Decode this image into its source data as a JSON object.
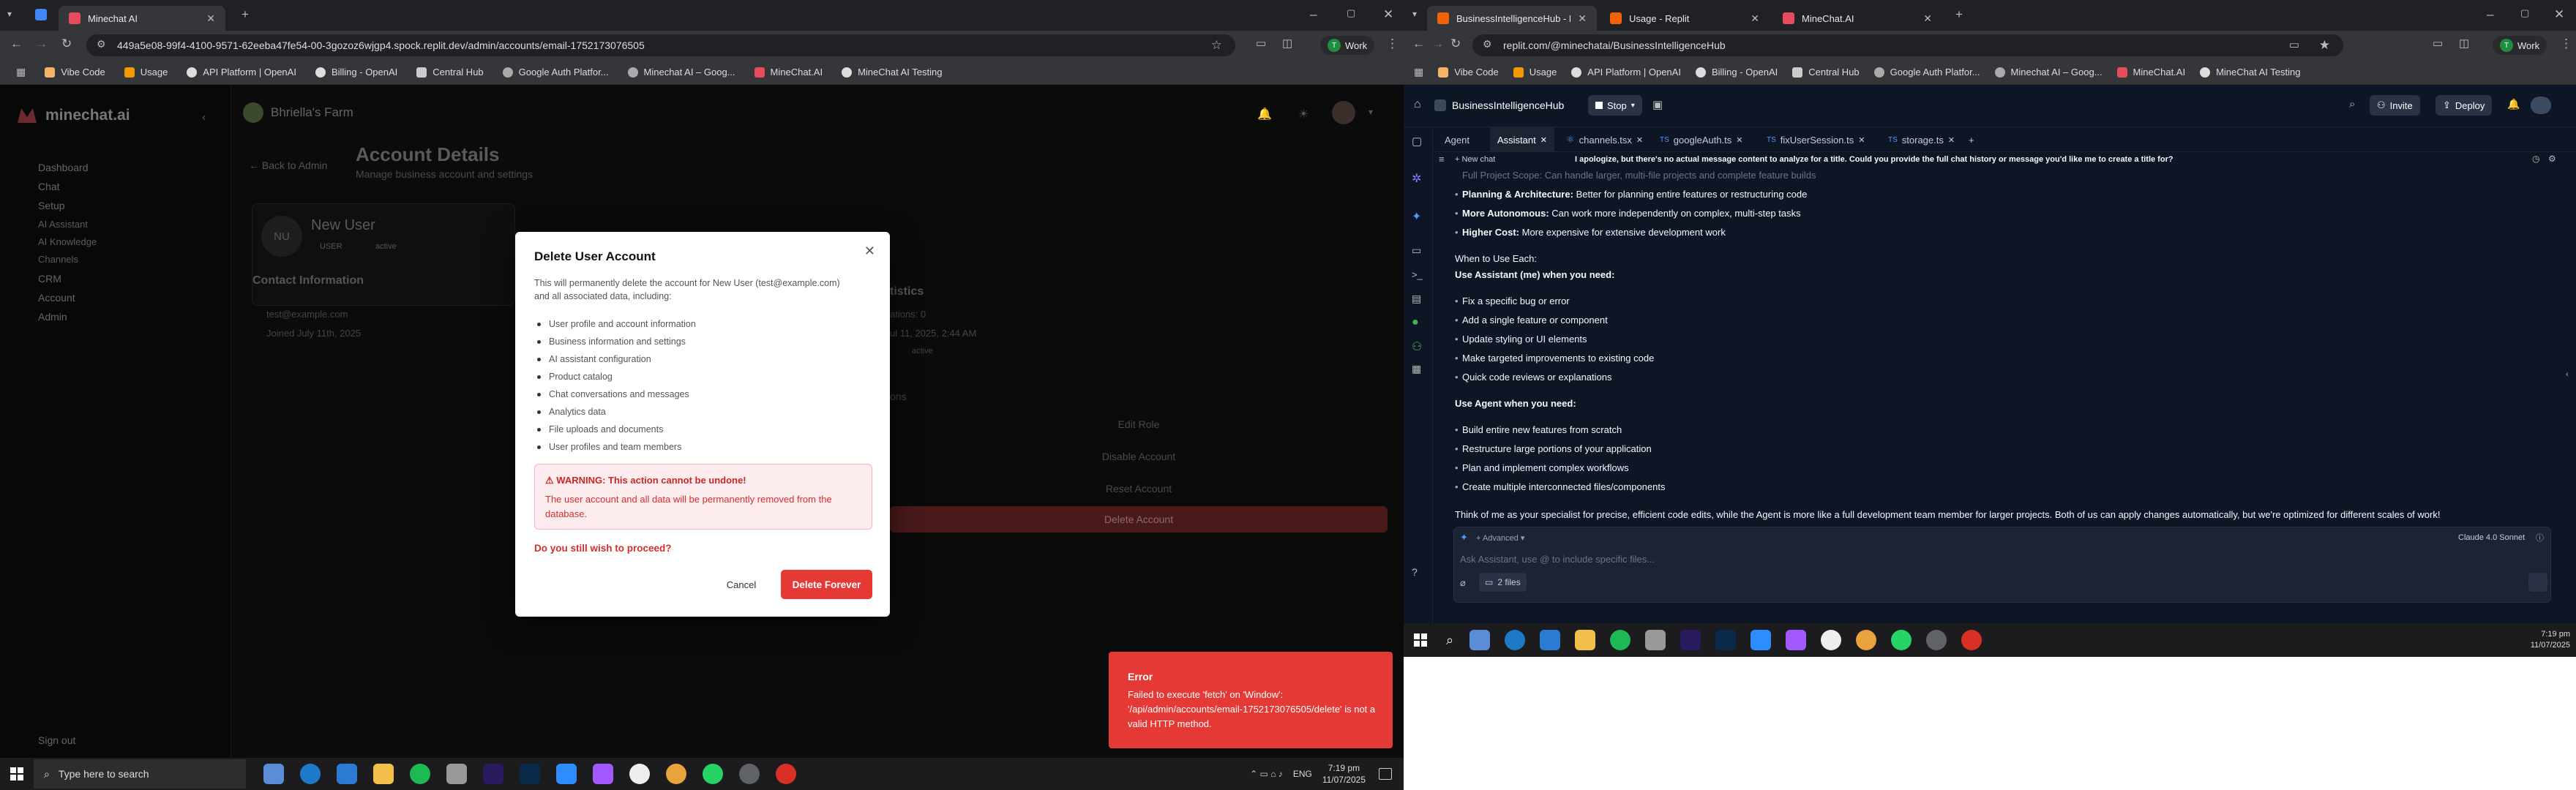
{
  "left_browser": {
    "tab_active": "Minechat AI",
    "url": "449a5e08-99f4-4100-9571-62eeba47fe54-00-3gozoz6wjgp4.spock.replit.dev/admin/accounts/email-1752173076505",
    "profile": "Work",
    "bookmarks": [
      "Vibe Code",
      "Usage",
      "API Platform | OpenAI",
      "Billing - OpenAI",
      "Central Hub",
      "Google Auth Platfor...",
      "Minechat AI – Goog...",
      "MineChat.AI",
      "MineChat AI Testing"
    ]
  },
  "app": {
    "brand": "minechat.ai",
    "workspace": "Bhriella's Farm",
    "sidebar": [
      "Dashboard",
      "Chat",
      "Setup",
      "AI Assistant",
      "AI Knowledge",
      "Channels",
      "CRM",
      "Account",
      "Admin"
    ],
    "signout": "Sign out",
    "back": "Back to Admin",
    "page_title": "Account Details",
    "page_subtitle": "Manage business account and settings",
    "avatar": "NU",
    "user_name": "New User",
    "role": "USER",
    "status": "active",
    "contact_title": "Contact Information",
    "email": "test@example.com",
    "joined": "Joined July 11th, 2025",
    "stats_title": "tistics",
    "stats_line1": "ations: 0",
    "stats_line2": "ul 11, 2025, 2:44 AM",
    "actions_label": "ons",
    "edit_role": "Edit Role",
    "disable": "Disable Account",
    "reset": "Reset Account",
    "delete": "Delete Account"
  },
  "modal": {
    "title": "Delete User Account",
    "desc": "This will permanently delete the account for New User (test@example.com) and all associated data, including:",
    "items": [
      "User profile and account information",
      "Business information and settings",
      "AI assistant configuration",
      "Product catalog",
      "Chat conversations and messages",
      "Analytics data",
      "File uploads and documents",
      "User profiles and team members"
    ],
    "warn_title": "WARNING: This action cannot be undone!",
    "warn_body": "The user account and all data will be permanently removed from the database.",
    "proceed": "Do you still wish to proceed?",
    "cancel": "Cancel",
    "confirm": "Delete Forever"
  },
  "toast": {
    "title": "Error",
    "body": "Failed to execute 'fetch' on 'Window': '/api/admin/accounts/email-1752173076505/delete' is not a valid HTTP method."
  },
  "taskbar_left": {
    "search": "Type here to search",
    "lang": "ENG",
    "time": "7:19 pm",
    "date": "11/07/2025"
  },
  "right_browser": {
    "tabs": [
      "BusinessIntelligenceHub - Repli",
      "Usage - Replit",
      "MineChat.AI"
    ],
    "url": "replit.com/@minechatai/BusinessIntelligenceHub",
    "profile": "Work",
    "bookmarks": [
      "Vibe Code",
      "Usage",
      "API Platform | OpenAI",
      "Billing - OpenAI",
      "Central Hub",
      "Google Auth Platfor...",
      "Minechat AI – Goog...",
      "MineChat.AI",
      "MineChat AI Testing"
    ]
  },
  "replit": {
    "project": "BusinessIntelligenceHub",
    "stop": "Stop",
    "invite": "Invite",
    "deploy": "Deploy",
    "tabs": [
      "Agent",
      "Assistant",
      "channels.tsx",
      "googleAuth.ts",
      "fixUserSession.ts",
      "storage.ts"
    ],
    "new_chat": "New chat",
    "chat_title": "I apologize, but there's no actual message content to analyze for a title. Could you provide the full chat history or message you'd like me to create a title for?",
    "line_partial": "Full Project Scope: Can handle larger, multi-file projects and complete feature builds",
    "b1_label": "Planning & Architecture:",
    "b1_text": "Better for planning entire features or restructuring code",
    "b2_label": "More Autonomous:",
    "b2_text": "Can work more independently on complex, multi-step tasks",
    "b3_label": "Higher Cost:",
    "b3_text": "More expensive for extensive development work",
    "when": "When to Use Each:",
    "assist_h": "Use Assistant (me) when you need:",
    "assist_items": [
      "Fix a specific bug or error",
      "Add a single feature or component",
      "Update styling or UI elements",
      "Make targeted improvements to existing code",
      "Quick code reviews or explanations"
    ],
    "agent_h": "Use Agent when you need:",
    "agent_items": [
      "Build entire new features from scratch",
      "Restructure large portions of your application",
      "Plan and implement complex workflows",
      "Create multiple interconnected files/components"
    ],
    "summary": "Think of me as your specialist for precise, efficient code edits, while the Agent is more like a full development team member for larger projects. Both of us can apply changes automatically, but we're optimized for different scales of work!",
    "advanced": "Advanced",
    "model": "Claude 4.0 Sonnet",
    "placeholder": "Ask Assistant, use @ to include specific files...",
    "files": "2 files"
  },
  "taskbar_right": {
    "time": "7:19 pm",
    "date": "11/07/2025"
  }
}
